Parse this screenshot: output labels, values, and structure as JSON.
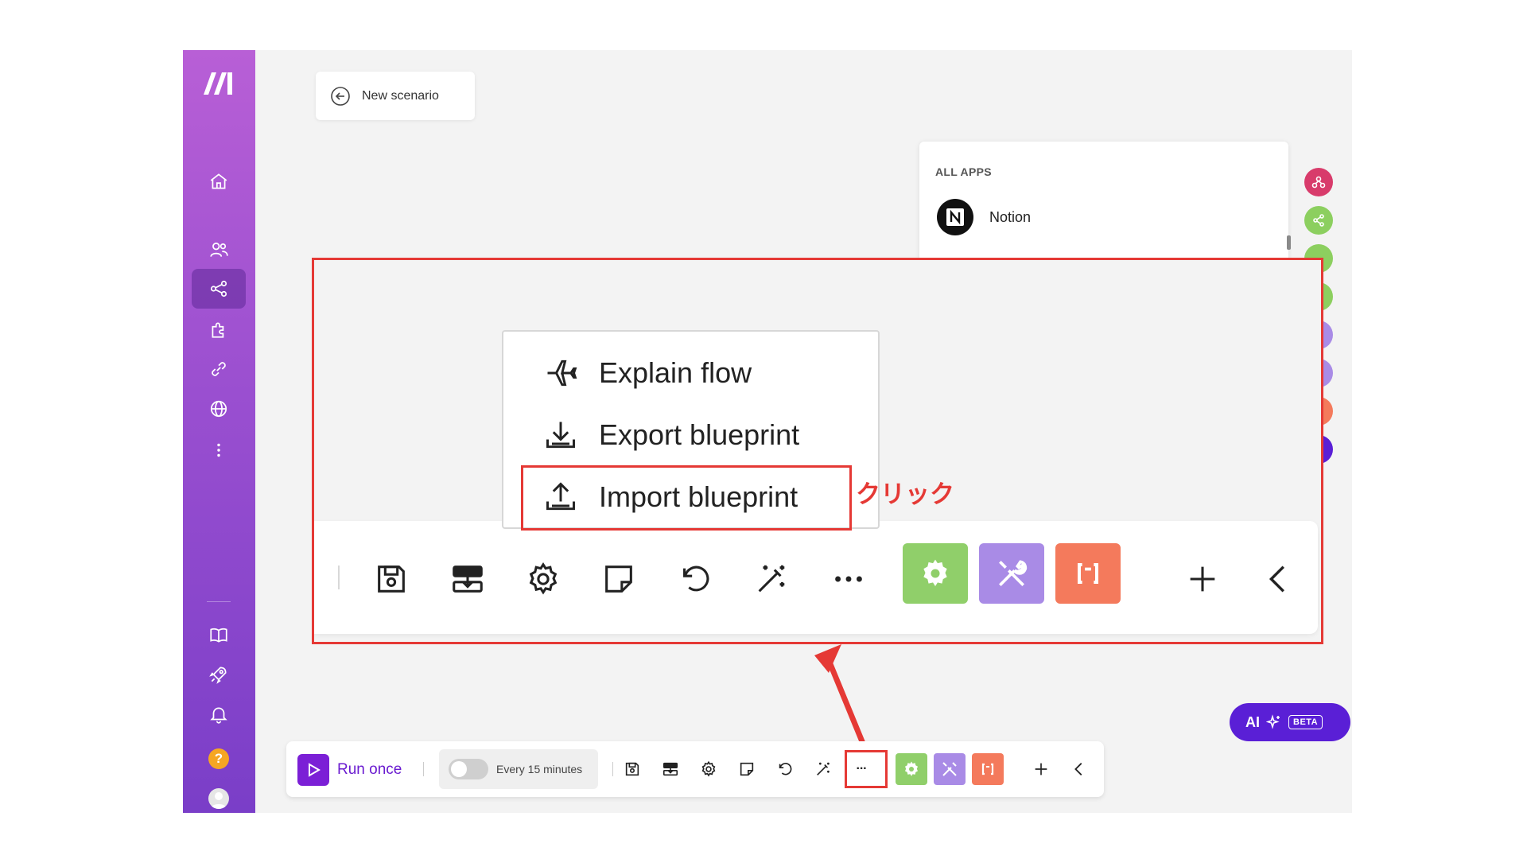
{
  "scenario": {
    "title": "New scenario"
  },
  "apps_panel": {
    "heading": "ALL APPS",
    "items": [
      {
        "label": "Notion"
      }
    ]
  },
  "menu": {
    "explain_flow": "Explain flow",
    "export_blueprint": "Export blueprint",
    "import_blueprint": "Import blueprint"
  },
  "annotation": {
    "click_label": "クリック"
  },
  "toolbar": {
    "run_once": "Run once",
    "schedule": "Every 15 minutes",
    "more": "···"
  },
  "ai_button": {
    "label": "AI",
    "badge": "BETA"
  },
  "colors": {
    "accent_purple": "#7b1fd6",
    "tile_green": "#90cf6a",
    "tile_lavender": "#a98be6",
    "tile_orange": "#f47a5c",
    "highlight_red": "#e53935"
  }
}
